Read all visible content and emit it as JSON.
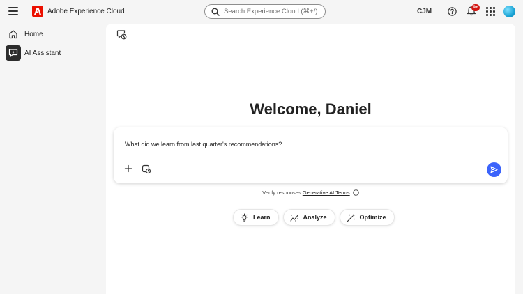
{
  "topbar": {
    "brand_name": "Adobe Experience Cloud",
    "search_placeholder": "Search Experience Cloud (⌘+/)",
    "org_label": "CJM",
    "notification_count": "9+"
  },
  "sidebar": {
    "items": [
      {
        "label": "Home",
        "icon": "home-icon"
      },
      {
        "label": "AI Assistant",
        "icon": "ai-assistant-icon",
        "active": true
      }
    ]
  },
  "main": {
    "welcome": "Welcome, Daniel",
    "prompt_value": "What did we learn from last quarter's recommendations?",
    "verify_text": "Verify responses",
    "verify_link": "Generative AI Terms",
    "chips": [
      {
        "label": "Learn",
        "icon": "lightbulb-icon"
      },
      {
        "label": "Analyze",
        "icon": "trend-line-icon"
      },
      {
        "label": "Optimize",
        "icon": "magic-wand-icon"
      }
    ]
  },
  "colors": {
    "brand": "#eb1000",
    "send_button": "#3b63fb",
    "badge": "#d31510"
  }
}
